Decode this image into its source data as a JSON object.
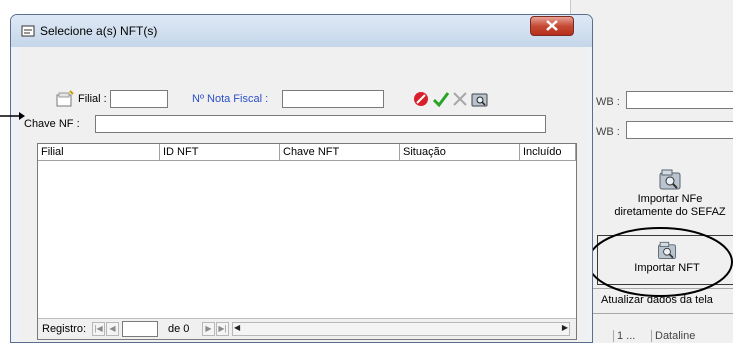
{
  "dialog": {
    "title": "Selecione a(s) NFT(s)",
    "filial_label": "Filial :",
    "filial_value": "",
    "nota_label": "Nº Nota Fiscal :",
    "nota_value": "",
    "chave_label": "Chave NF :",
    "chave_value": "",
    "columns": [
      "Filial",
      "ID NFT",
      "Chave NFT",
      "Situação",
      "Incluído"
    ],
    "registro_label": "Registro:",
    "registro_value": "",
    "de_label": "de 0"
  },
  "background": {
    "wb_label_1": "WB :",
    "wb_label_2": "WB :",
    "import_sefaz_line1": "Importar NFe",
    "import_sefaz_line2": "diretamente do SEFAZ",
    "import_nft": "Importar NFT",
    "refresh": "Atualizar dados da tela",
    "bottom_tab_1": "1 ...",
    "bottom_tab_2": "Dataline"
  },
  "colors": {
    "accent_blue": "#2b4fc7",
    "close_red": "#c54a36",
    "cancel_red": "#d8202a",
    "confirm_green": "#28a528"
  }
}
